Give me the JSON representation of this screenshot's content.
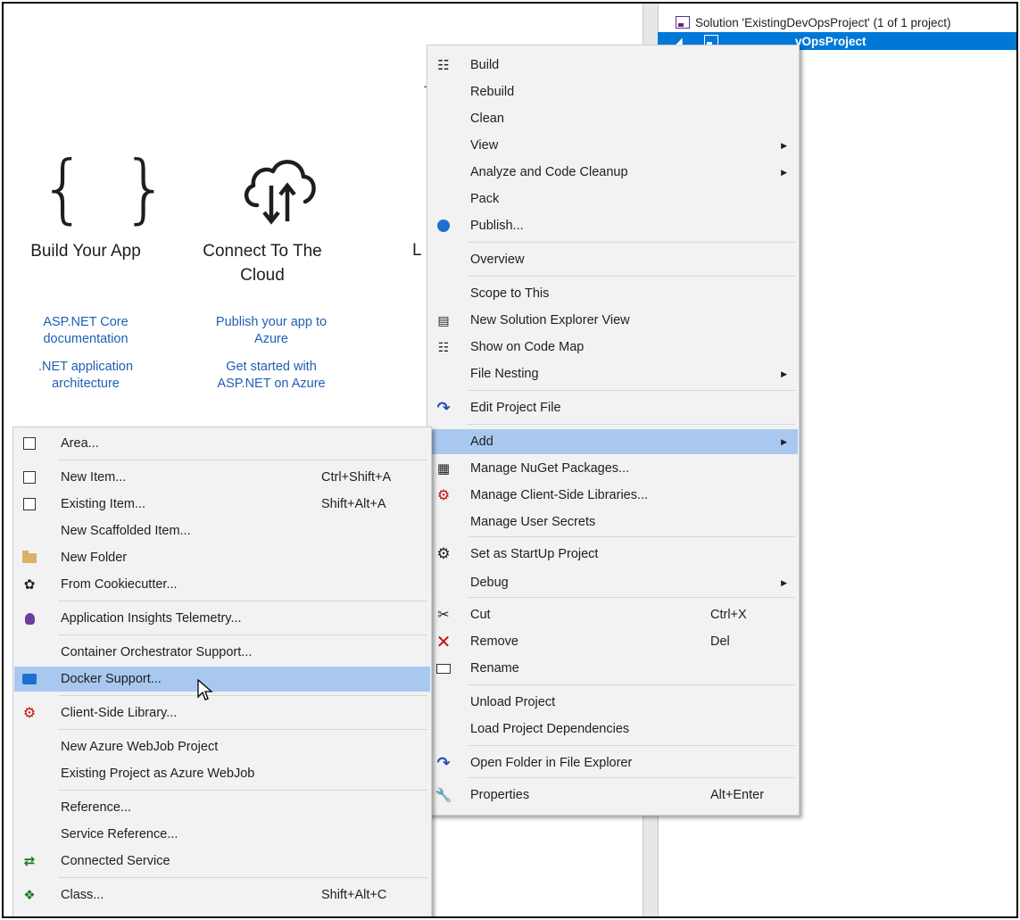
{
  "solution_explorer": {
    "solution_label": "Solution 'ExistingDevOpsProject' (1 of 1 project)",
    "project_label": "vOpsProject"
  },
  "welcome": {
    "build": {
      "title": "Build Your App",
      "links": [
        "ASP.NET Core documentation",
        ".NET application architecture"
      ]
    },
    "cloud": {
      "title": "Connect To The Cloud",
      "links": [
        "Publish your app to Azure",
        "Get started with ASP.NET on Azure"
      ]
    },
    "partial_title": "L"
  },
  "project_menu": {
    "items": [
      {
        "label": "Build",
        "icon": "build-icon"
      },
      {
        "label": "Rebuild"
      },
      {
        "label": "Clean"
      },
      {
        "label": "View",
        "submenu": true
      },
      {
        "label": "Analyze and Code Cleanup",
        "submenu": true
      },
      {
        "label": "Pack"
      },
      {
        "label": "Publish...",
        "icon": "publish-icon"
      },
      {
        "label": "Overview"
      },
      {
        "label": "Scope to This"
      },
      {
        "label": "New Solution Explorer View",
        "icon": "new-view-icon"
      },
      {
        "label": "Show on Code Map",
        "icon": "code-map-icon"
      },
      {
        "label": "File Nesting",
        "submenu": true
      },
      {
        "label": "Edit Project File",
        "icon": "edit-file-icon"
      },
      {
        "label": "Add",
        "submenu": true,
        "selected": true
      },
      {
        "label": "Manage NuGet Packages...",
        "icon": "nuget-icon"
      },
      {
        "label": "Manage Client-Side Libraries...",
        "icon": "library-icon"
      },
      {
        "label": "Manage User Secrets"
      },
      {
        "label": "Set as StartUp Project",
        "icon": "gear-icon"
      },
      {
        "label": "Debug",
        "submenu": true
      },
      {
        "label": "Cut",
        "icon": "cut-icon",
        "shortcut": "Ctrl+X"
      },
      {
        "label": "Remove",
        "icon": "remove-icon",
        "shortcut": "Del"
      },
      {
        "label": "Rename",
        "icon": "rename-icon"
      },
      {
        "label": "Unload Project"
      },
      {
        "label": "Load Project Dependencies"
      },
      {
        "label": "Open Folder in File Explorer",
        "icon": "open-folder-icon"
      },
      {
        "label": "Properties",
        "icon": "wrench-icon",
        "shortcut": "Alt+Enter"
      }
    ]
  },
  "add_menu": {
    "items": [
      {
        "label": "Area...",
        "icon": "area-icon"
      },
      {
        "label": "New Item...",
        "icon": "new-item-icon",
        "shortcut": "Ctrl+Shift+A"
      },
      {
        "label": "Existing Item...",
        "icon": "existing-item-icon",
        "shortcut": "Shift+Alt+A"
      },
      {
        "label": "New Scaffolded Item..."
      },
      {
        "label": "New Folder",
        "icon": "new-folder-icon"
      },
      {
        "label": "From Cookiecutter...",
        "icon": "cookiecutter-icon"
      },
      {
        "label": "Application Insights Telemetry...",
        "icon": "insights-icon"
      },
      {
        "label": "Container Orchestrator Support..."
      },
      {
        "label": "Docker Support...",
        "icon": "docker-icon",
        "selected": true
      },
      {
        "label": "Client-Side Library...",
        "icon": "library-icon"
      },
      {
        "label": "New Azure WebJob Project"
      },
      {
        "label": "Existing Project as Azure WebJob"
      },
      {
        "label": "Reference..."
      },
      {
        "label": "Service Reference..."
      },
      {
        "label": "Connected Service",
        "icon": "connected-service-icon"
      },
      {
        "label": "Class...",
        "icon": "class-icon",
        "shortcut": "Shift+Alt+C"
      }
    ]
  }
}
